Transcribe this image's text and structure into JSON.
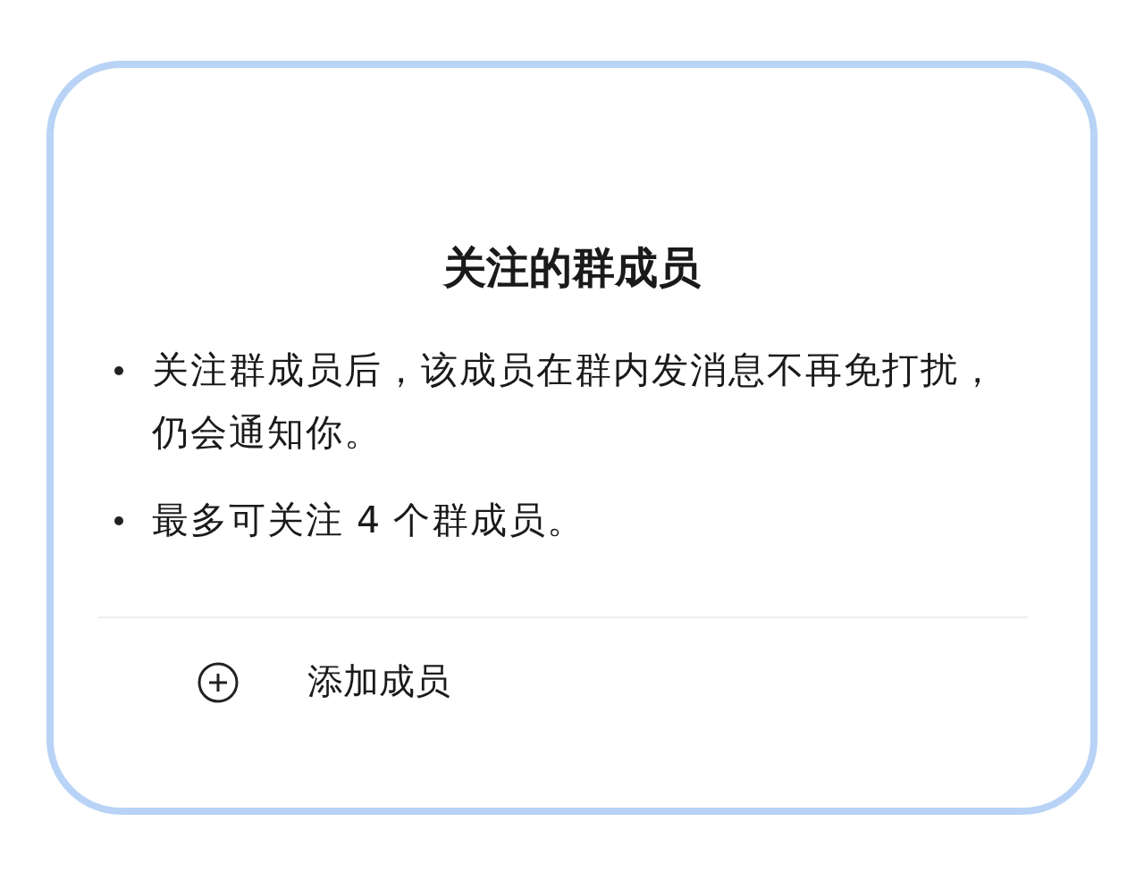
{
  "dialog": {
    "title": "关注的群成员",
    "bullets": [
      "关注群成员后，该成员在群内发消息不再免打扰，仍会通知你。",
      "最多可关注 4 个群成员。"
    ],
    "add_button": {
      "label": "添加成员"
    }
  }
}
